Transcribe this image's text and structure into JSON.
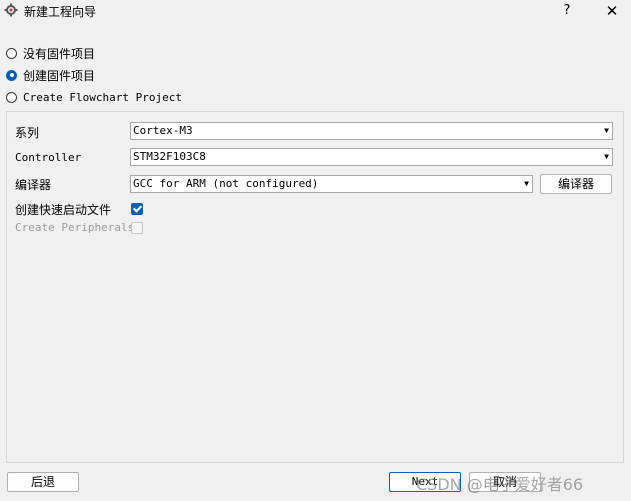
{
  "window": {
    "title": "新建工程向导",
    "help_label": "?",
    "close_label": "✕",
    "app_icon": "gear-app-icon"
  },
  "project_type": {
    "options": [
      {
        "label": "没有固件项目",
        "checked": false
      },
      {
        "label": "创建固件项目",
        "checked": true
      },
      {
        "label": "Create Flowchart Project",
        "checked": false
      }
    ]
  },
  "form": {
    "series_label": "系列",
    "series_value": "Cortex-M3",
    "controller_label": "Controller",
    "controller_value": "STM32F103C8",
    "compiler_label": "编译器",
    "compiler_value": "GCC for ARM (not configured)",
    "compiler_button": "编译器",
    "quick_start_label": "创建快速启动文件",
    "quick_start_checked": true,
    "peripherals_label": "Create Peripherals",
    "peripherals_checked": false,
    "peripherals_enabled": false
  },
  "footer": {
    "back_label": "后退",
    "next_label": "Next",
    "cancel_label": "取消"
  },
  "watermark": "CSDN @电子爱好者66",
  "colors": {
    "accent": "#0a5fb4",
    "background": "#f0f0f0"
  }
}
